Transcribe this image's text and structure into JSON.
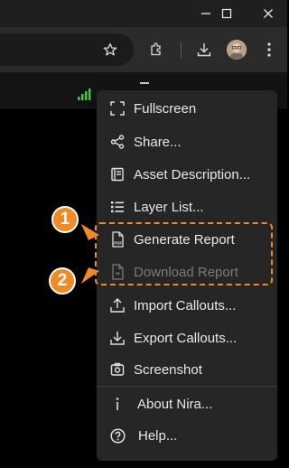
{
  "browser": {
    "window_controls": [
      "minimize-icon",
      "maximize-icon",
      "close-icon"
    ],
    "toolbar_icons": [
      "star-icon",
      "extensions-icon",
      "download-icon",
      "avatar",
      "more-vert-icon"
    ]
  },
  "menu": {
    "items": [
      {
        "label": "Fullscreen",
        "icon": "fullscreen-icon",
        "disabled": false
      },
      {
        "label": "Share...",
        "icon": "share-icon",
        "disabled": false
      },
      {
        "label": "Asset Description...",
        "icon": "document-icon",
        "disabled": false
      },
      {
        "label": "Layer List...",
        "icon": "list-icon",
        "disabled": false
      },
      {
        "label": "Generate Report",
        "icon": "pdf-icon",
        "disabled": false
      },
      {
        "label": "Download Report",
        "icon": "file-download-icon",
        "disabled": true
      },
      {
        "label": "Import Callouts...",
        "icon": "upload-icon",
        "disabled": false
      },
      {
        "label": "Export Callouts...",
        "icon": "download-icon",
        "disabled": false
      },
      {
        "label": "Screenshot",
        "icon": "screenshot-icon",
        "disabled": false
      },
      {
        "label": "About Nira...",
        "icon": "info-icon",
        "disabled": false
      },
      {
        "label": "Help...",
        "icon": "help-icon",
        "disabled": false
      }
    ]
  },
  "annotations": {
    "badge_1": "1",
    "badge_2": "2",
    "accent_color": "#f08a24"
  },
  "colors": {
    "menu_bg": "#262626",
    "text": "#e8e8e8",
    "disabled_text": "#7a7a7a",
    "signal_green": "#3ecf4a"
  }
}
